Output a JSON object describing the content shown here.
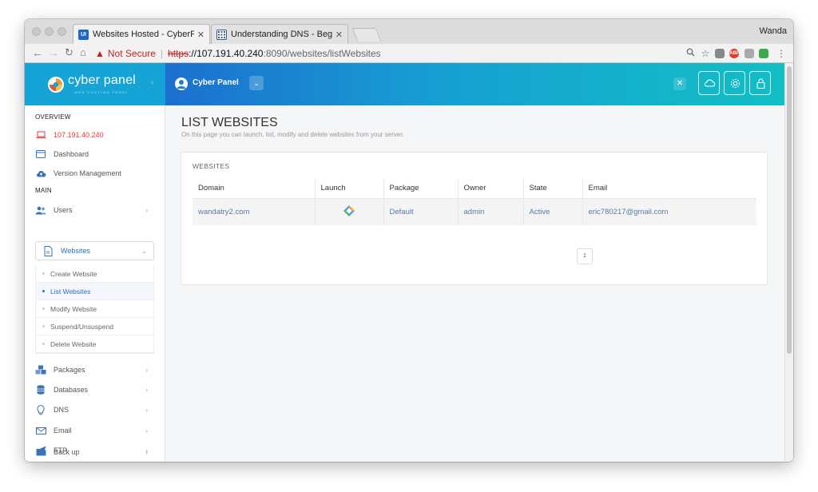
{
  "browser": {
    "tabs": [
      {
        "title": "Websites Hosted - CyberPanel",
        "favicon": "UI"
      },
      {
        "title": "Understanding DNS - Beginne",
        "favicon": "grid"
      }
    ],
    "profile": "Wanda",
    "not_secure": "Not Secure",
    "url_scheme": "https",
    "url_host": "://107.191.40.240",
    "url_rest": ":8090/websites/listWebsites",
    "ext_adblock": "ABP"
  },
  "header": {
    "brand": "cyber panel",
    "brand_sub": "WEB HOSTING PANEL",
    "user": "Cyber Panel"
  },
  "sidebar": {
    "overview_label": "OVERVIEW",
    "ip": "107.191.40.240",
    "dashboard": "Dashboard",
    "version": "Version Management",
    "main_label": "MAIN",
    "users": "Users",
    "websites": "Websites",
    "submenu": [
      "Create Website",
      "List Websites",
      "Modify Website",
      "Suspend/Unsuspend",
      "Delete Website"
    ],
    "packages": "Packages",
    "databases": "Databases",
    "dns": "DNS",
    "email": "Email",
    "ftp": "FTP",
    "backup": "Back up"
  },
  "main": {
    "title": "LIST WEBSITES",
    "subtitle": "On this page you can launch, list, modify and delete websites from your server.",
    "panel_title": "WEBSITES",
    "columns": [
      "Domain",
      "Launch",
      "Package",
      "Owner",
      "State",
      "Email"
    ],
    "rows": [
      {
        "domain": "wandatry2.com",
        "package": "Default",
        "owner": "admin",
        "state": "Active",
        "email": "eric780217@gmail.com"
      }
    ],
    "page": "1"
  },
  "colors": {
    "brand": "#16a3d5",
    "header_start": "#1c6fcf",
    "header_end": "#12bfc4",
    "danger": "#c5221f",
    "link": "#2a6fbd"
  }
}
